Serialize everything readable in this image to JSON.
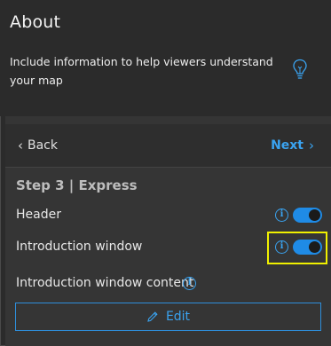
{
  "about": {
    "title": "About",
    "description": "Include information to help viewers understand your map",
    "icon": "lightbulb-icon"
  },
  "nav": {
    "back_label": "Back",
    "next_label": "Next"
  },
  "step_title": "Step 3 | Express",
  "settings": [
    {
      "label": "Header",
      "enabled": true
    },
    {
      "label": "Introduction window",
      "enabled": true
    },
    {
      "label": "Introduction window content"
    }
  ],
  "edit_label": "Edit",
  "colors": {
    "accent": "#3aa3f0",
    "highlight": "#f0f000",
    "background": "#2b2b2b"
  }
}
